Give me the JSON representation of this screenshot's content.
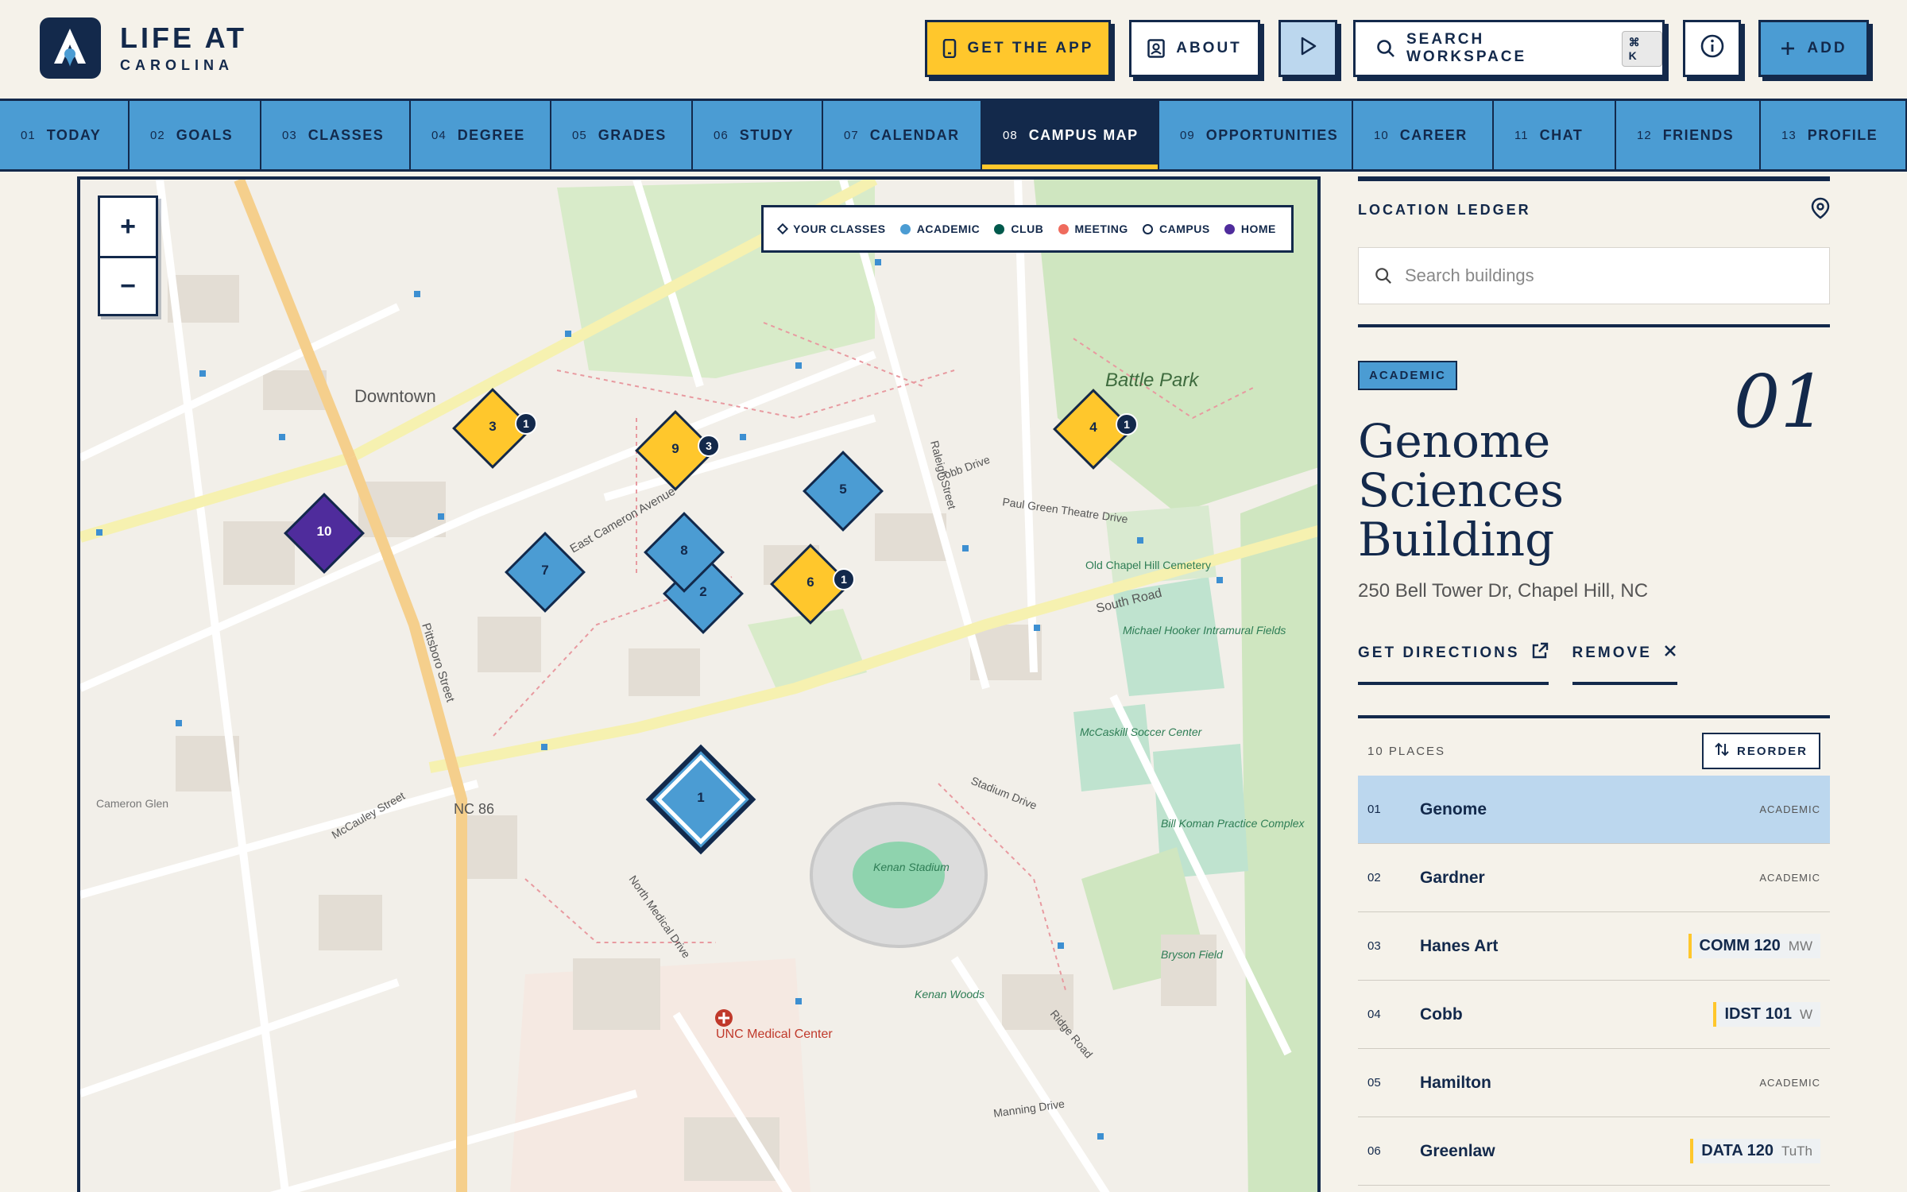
{
  "brand": {
    "line1": "LIFE AT",
    "line2": "CAROLINA"
  },
  "header": {
    "get_app": "GET THE APP",
    "about": "ABOUT",
    "search": "SEARCH WORKSPACE",
    "search_shortcut": "⌘ K",
    "add": "ADD"
  },
  "nav": {
    "tabs": [
      {
        "num": "01",
        "label": "TODAY"
      },
      {
        "num": "02",
        "label": "GOALS"
      },
      {
        "num": "03",
        "label": "CLASSES"
      },
      {
        "num": "04",
        "label": "DEGREE"
      },
      {
        "num": "05",
        "label": "GRADES"
      },
      {
        "num": "06",
        "label": "STUDY"
      },
      {
        "num": "07",
        "label": "CALENDAR"
      },
      {
        "num": "08",
        "label": "CAMPUS MAP"
      },
      {
        "num": "09",
        "label": "OPPORTUNITIES"
      },
      {
        "num": "10",
        "label": "CAREER"
      },
      {
        "num": "11",
        "label": "CHAT"
      },
      {
        "num": "12",
        "label": "FRIENDS"
      },
      {
        "num": "13",
        "label": "PROFILE"
      }
    ],
    "active_index": 7
  },
  "map": {
    "zoom_in": "+",
    "zoom_out": "−",
    "legend": [
      {
        "label": "YOUR CLASSES",
        "color": "#13294b"
      },
      {
        "label": "ACADEMIC",
        "color": "#4b9cd3"
      },
      {
        "label": "CLUB",
        "color": "#00594c"
      },
      {
        "label": "MEETING",
        "color": "#ef6b5d"
      },
      {
        "label": "CAMPUS",
        "color": "#ffffff"
      },
      {
        "label": "HOME",
        "color": "#4f2c9c"
      }
    ],
    "place_labels": {
      "downtown": "Downtown",
      "battle_park": "Battle Park",
      "kenan_stadium": "Kenan Stadium",
      "unc_medical": "UNC Medical Center",
      "nc86": "NC 86",
      "south_road": "South Road",
      "cameron_avenue": "East Cameron Avenue",
      "pittsboro": "Pittsboro Street",
      "raleigh": "Raleigh Street",
      "stadium_drive": "Stadium Drive",
      "mccauley": "McCauley Street",
      "old_chapel_hill_cemetery": "Old Chapel Hill Cemetery",
      "mccaskill_soccer": "McCaskill Soccer Center",
      "bill_koman": "Bill Koman Practice Complex",
      "hooker_fields": "Michael Hooker Intramural Fields",
      "bryson_field": "Bryson Field",
      "kenan_woods": "Kenan Woods",
      "manning_drive": "Manning Drive",
      "ridge_road": "Ridge Road",
      "north_medical": "North Medical Drive",
      "paul_green": "Paul Green Theatre Drive",
      "cameron_glen": "Cameron Glen",
      "cobb_drive": "Cobb Drive"
    },
    "markers": [
      {
        "label": "1",
        "type": "academic",
        "selected": true
      },
      {
        "label": "2",
        "type": "academic"
      },
      {
        "label": "3",
        "type": "class",
        "badge": "1"
      },
      {
        "label": "4",
        "type": "class",
        "badge": "1"
      },
      {
        "label": "5",
        "type": "academic"
      },
      {
        "label": "6",
        "type": "class",
        "badge": "1"
      },
      {
        "label": "7",
        "type": "academic"
      },
      {
        "label": "8",
        "type": "academic"
      },
      {
        "label": "9",
        "type": "class",
        "badge": "3"
      },
      {
        "label": "10",
        "type": "home"
      }
    ]
  },
  "ledger": {
    "title": "LOCATION LEDGER",
    "search_placeholder": "Search buildings",
    "selected": {
      "badge": "ACADEMIC",
      "index": "01",
      "name": "Genome Sciences Building",
      "address": "250 Bell Tower Dr, Chapel Hill, NC",
      "directions": "GET DIRECTIONS",
      "remove": "REMOVE"
    },
    "places_count": "10 PLACES",
    "reorder": "REORDER",
    "places": [
      {
        "num": "01",
        "name": "Genome",
        "type": "ACADEMIC"
      },
      {
        "num": "02",
        "name": "Gardner",
        "type": "ACADEMIC"
      },
      {
        "num": "03",
        "name": "Hanes Art",
        "course": "COMM 120",
        "days": "MW"
      },
      {
        "num": "04",
        "name": "Cobb",
        "course": "IDST 101",
        "days": "W"
      },
      {
        "num": "05",
        "name": "Hamilton",
        "type": "ACADEMIC"
      },
      {
        "num": "06",
        "name": "Greenlaw",
        "course": "DATA 120",
        "days": "TuTh"
      }
    ]
  },
  "colors": {
    "navy": "#13294b",
    "carolina_blue": "#4b9cd3",
    "gold": "#ffc72c",
    "home_purple": "#4f2c9c",
    "light_blue": "#bcd7ee"
  }
}
